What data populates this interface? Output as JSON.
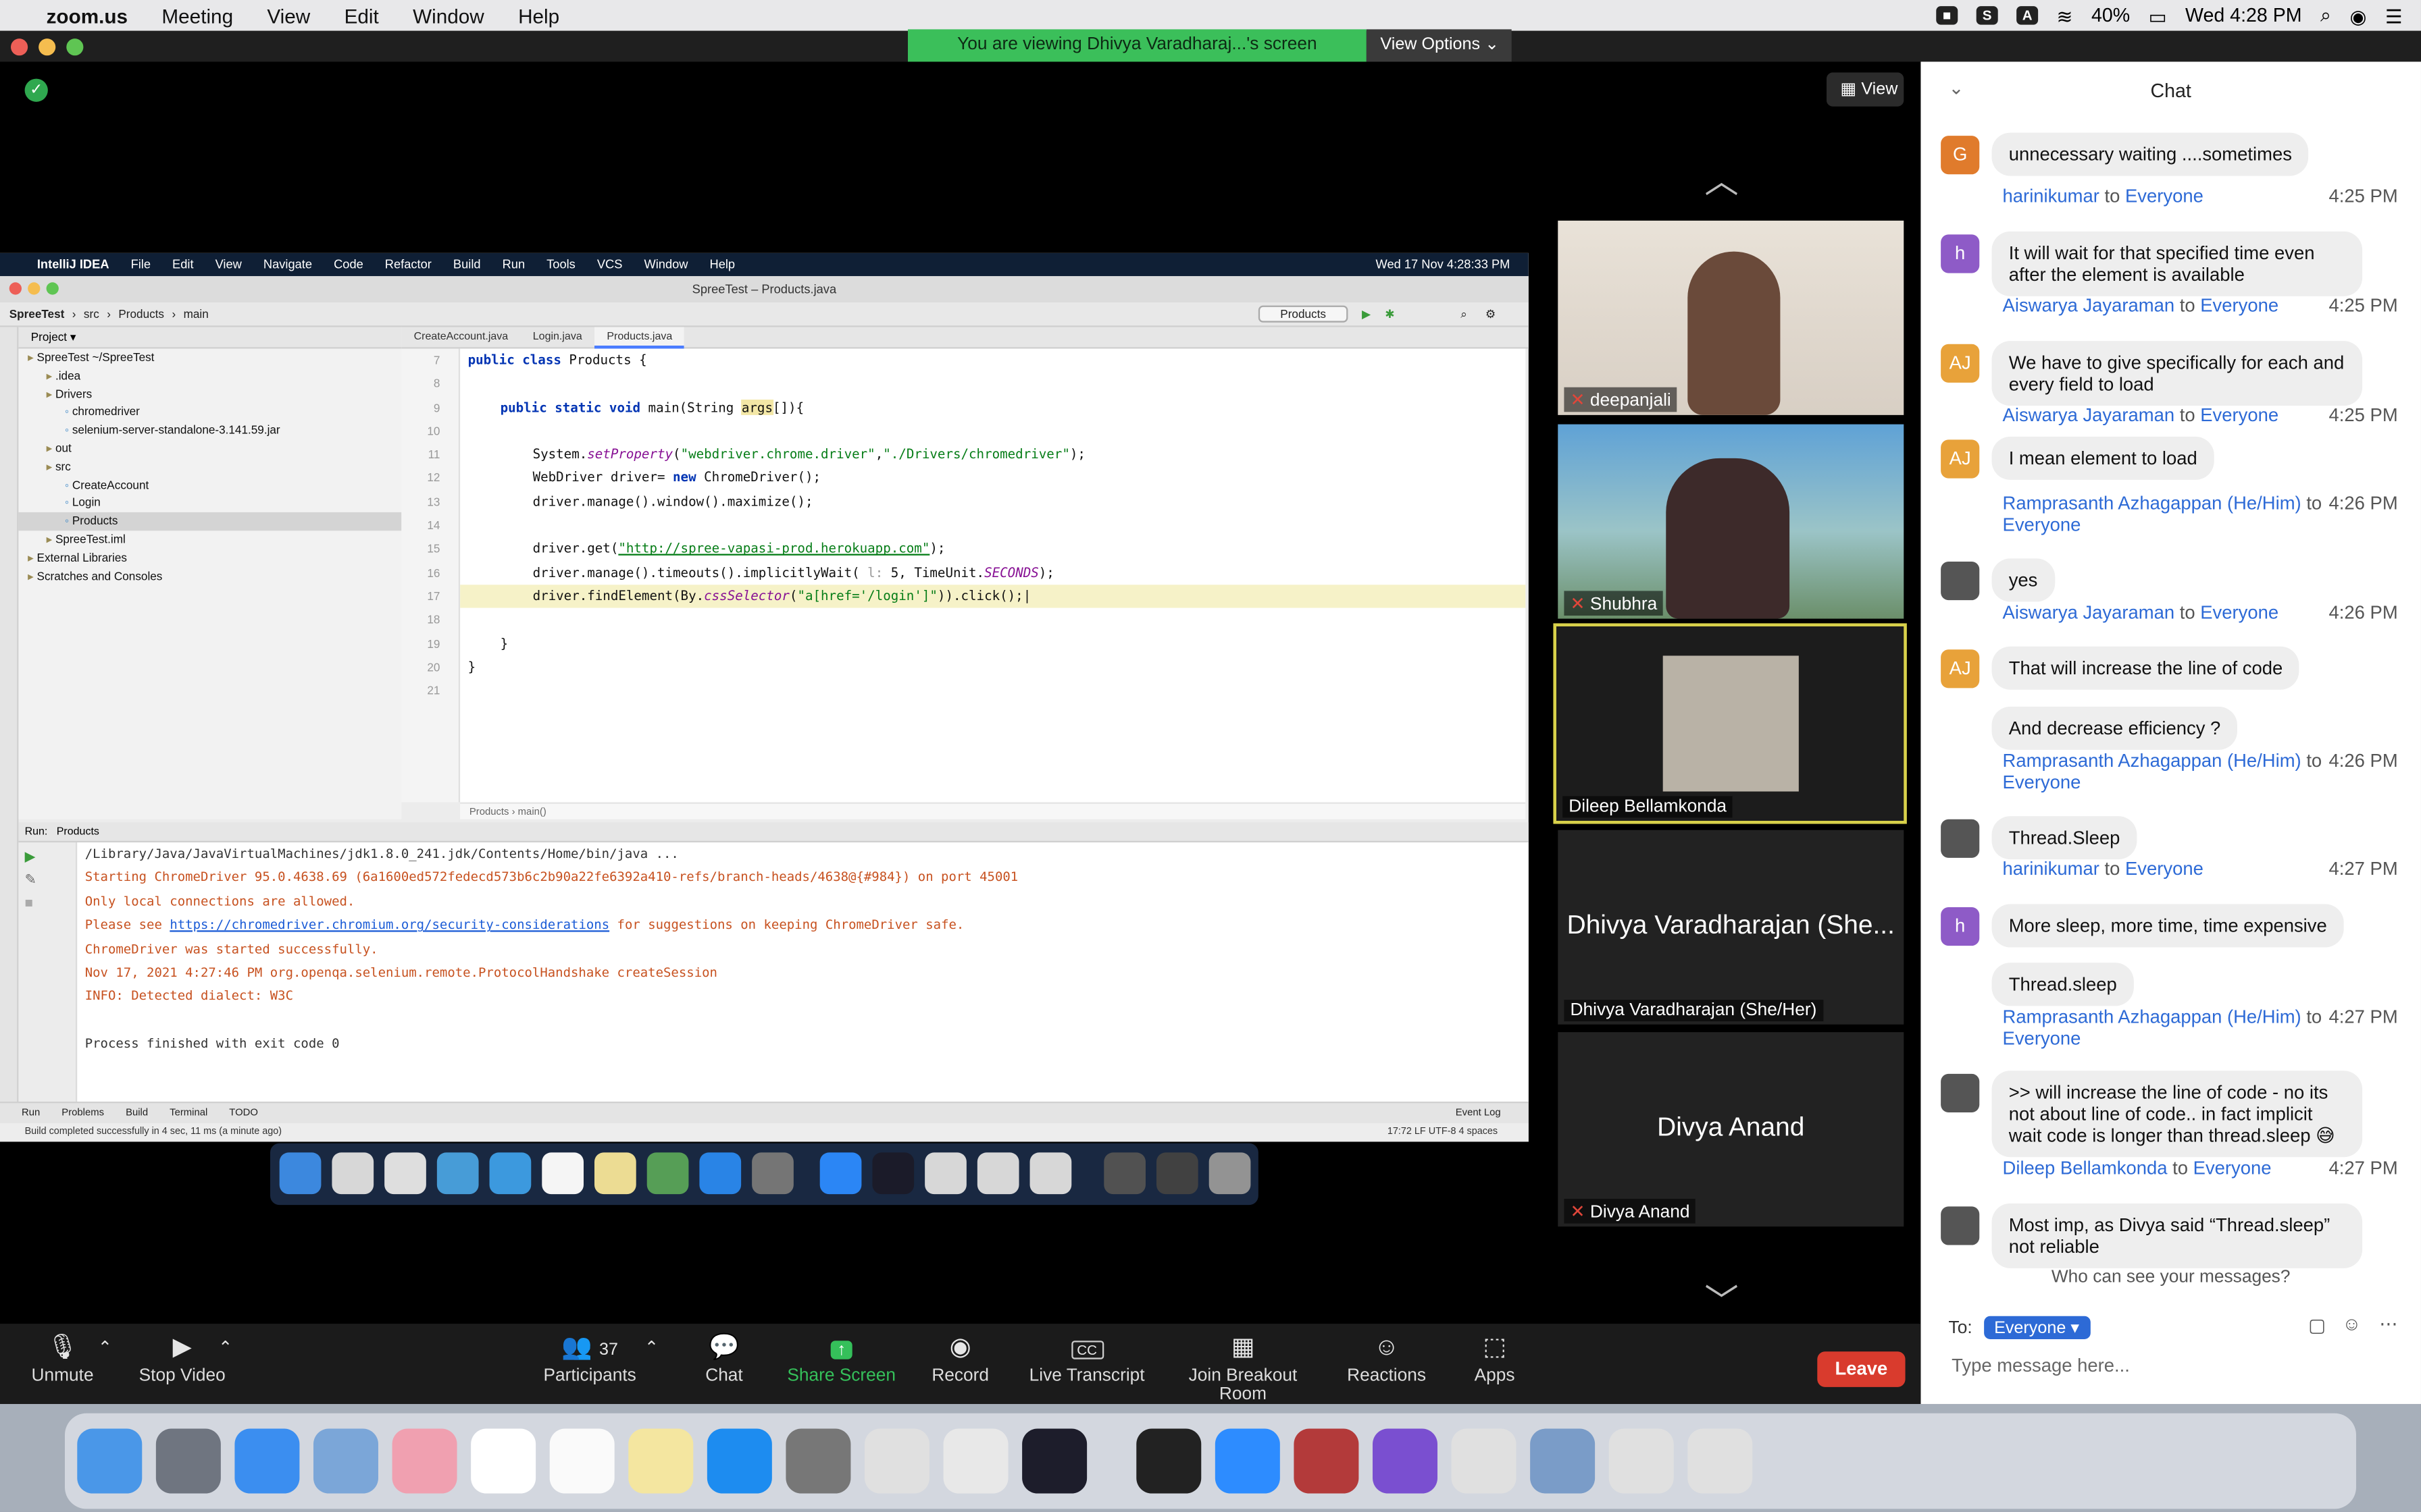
{
  "menubar": {
    "app": "zoom.us",
    "items": [
      "Meeting",
      "View",
      "Edit",
      "Window",
      "Help"
    ],
    "battery": "40%",
    "clock": "Wed 4:28 PM"
  },
  "zoom": {
    "viewing_banner": "You are viewing Dhivya Varadharaj...'s screen",
    "view_options": "View Options",
    "view_button": "View",
    "toolbar": {
      "unmute": "Unmute",
      "stop_video": "Stop Video",
      "participants": "Participants",
      "participants_count": "37",
      "chat": "Chat",
      "share_screen": "Share Screen",
      "record": "Record",
      "live_transcript": "Live Transcript",
      "breakout": "Join Breakout Room",
      "reactions": "Reactions",
      "apps": "Apps",
      "leave": "Leave"
    }
  },
  "shared": {
    "ij_menu": [
      "IntelliJ IDEA",
      "File",
      "Edit",
      "View",
      "Navigate",
      "Code",
      "Refactor",
      "Build",
      "Run",
      "Tools",
      "VCS",
      "Window",
      "Help"
    ],
    "ij_clock": "Wed 17 Nov  4:28:33 PM",
    "ij_title": "SpreeTest – Products.java",
    "crumbs": [
      "SpreeTest",
      "src",
      "Products",
      "main"
    ],
    "run_config": "Products",
    "tabs": [
      "CreateAccount.java",
      "Login.java",
      "Products.java"
    ],
    "project_label": "Project",
    "tree": [
      {
        "t": "SpreeTest ~/SpreeTest",
        "i": 0
      },
      {
        "t": ".idea",
        "i": 1
      },
      {
        "t": "Drivers",
        "i": 1
      },
      {
        "t": "chromedriver",
        "i": 2
      },
      {
        "t": "selenium-server-standalone-3.141.59.jar",
        "i": 2
      },
      {
        "t": "out",
        "i": 1
      },
      {
        "t": "src",
        "i": 1
      },
      {
        "t": "CreateAccount",
        "i": 2
      },
      {
        "t": "Login",
        "i": 2
      },
      {
        "t": "Products",
        "i": 2
      },
      {
        "t": "SpreeTest.iml",
        "i": 1
      },
      {
        "t": "External Libraries",
        "i": 0
      },
      {
        "t": "Scratches and Consoles",
        "i": 0
      }
    ],
    "line_numbers": [
      "7",
      "8",
      "9",
      "10",
      "11",
      "12",
      "13",
      "14",
      "15",
      "16",
      "17",
      "18",
      "19",
      "20",
      "21"
    ],
    "code_breadcrumb": "Products  ›  main()",
    "run_label": "Run:",
    "run_tab": "Products",
    "console": [
      "/Library/Java/JavaVirtualMachines/jdk1.8.0_241.jdk/Contents/Home/bin/java ...",
      "Starting ChromeDriver 95.0.4638.69 (6a1600ed572fedecd573b6c2b90a22fe6392a410-refs/branch-heads/4638@{#984}) on port 45001",
      "Only local connections are allowed.",
      "Please see https://chromedriver.chromium.org/security-considerations for suggestions on keeping ChromeDriver safe.",
      "ChromeDriver was started successfully.",
      "Nov 17, 2021 4:27:46 PM org.openqa.selenium.remote.ProtocolHandshake createSession",
      "INFO: Detected dialect: W3C",
      "",
      "Process finished with exit code 0"
    ],
    "tool_tabs": [
      "Run",
      "Problems",
      "Build",
      "Terminal",
      "TODO"
    ],
    "event_log": "Event Log",
    "status": "Build completed successfully in 4 sec, 11 ms (a minute ago)",
    "status_right": "17:72   LF   UTF-8   4 spaces"
  },
  "gallery": [
    {
      "name": "deepanjali",
      "muted": true
    },
    {
      "name": "Shubhra",
      "muted": true
    },
    {
      "name": "Dileep Bellamkonda",
      "muted": false
    },
    {
      "name": "Dhivya Varadharajan (She/Her)",
      "big": "Dhivya Varadharajan (She...",
      "muted": false
    },
    {
      "name": "Divya Anand",
      "big": "Divya Anand",
      "muted": true
    }
  ],
  "chat": {
    "title": "Chat",
    "who_can_see": "Who can see your messages?",
    "to_label": "To:",
    "to_value": "Everyone",
    "placeholder": "Type message here...",
    "messages": [
      {
        "text": "unnecessary waiting ....sometimes",
        "initial": "G",
        "color": "#e07b2c"
      },
      {
        "sender": "harinikumar",
        "to": "Everyone",
        "time": "4:25 PM",
        "text": "It will wait for that specified time even after the element is available",
        "initial": "h",
        "color": "#8e5bc7"
      },
      {
        "sender": "Aiswarya Jayaraman",
        "to": "Everyone",
        "time": "4:25 PM",
        "text": "We have to give specifically for each and every field to load",
        "initial": "AJ",
        "color": "#e8a23a"
      },
      {
        "sender": "Aiswarya Jayaraman",
        "to": "Everyone",
        "time": "4:25 PM",
        "text": "I mean element to load",
        "initial": "AJ",
        "color": "#e8a23a"
      },
      {
        "sender": "Ramprasanth Azhagappan (He/Him)",
        "to": "Everyone",
        "time": "4:26 PM",
        "text": "yes",
        "initial": "",
        "color": "#555"
      },
      {
        "sender": "Aiswarya Jayaraman",
        "to": "Everyone",
        "time": "4:26 PM",
        "text": "That will increase the line of code",
        "initial": "AJ",
        "color": "#e8a23a"
      },
      {
        "text": "And decrease efficiency ?"
      },
      {
        "sender": "Ramprasanth Azhagappan (He/Him)",
        "to": "Everyone",
        "time": "4:26 PM",
        "text": "Thread.Sleep",
        "initial": "",
        "color": "#555"
      },
      {
        "sender": "harinikumar",
        "to": "Everyone",
        "time": "4:27 PM",
        "text": "More sleep, more time, time expensive",
        "initial": "h",
        "color": "#8e5bc7"
      },
      {
        "text": "Thread.sleep"
      },
      {
        "sender": "Ramprasanth Azhagappan (He/Him)",
        "to": "Everyone",
        "time": "4:27 PM",
        "text": ">> will increase the line of code - no its not about line of code.. in fact implicit wait code is longer than thread.sleep 😅",
        "initial": "",
        "color": "#555"
      },
      {
        "sender": "Dileep Bellamkonda",
        "to": "Everyone",
        "time": "4:27 PM",
        "text": "Most imp, as Divya said “Thread.sleep” not reliable",
        "initial": "",
        "color": "#555"
      }
    ]
  }
}
